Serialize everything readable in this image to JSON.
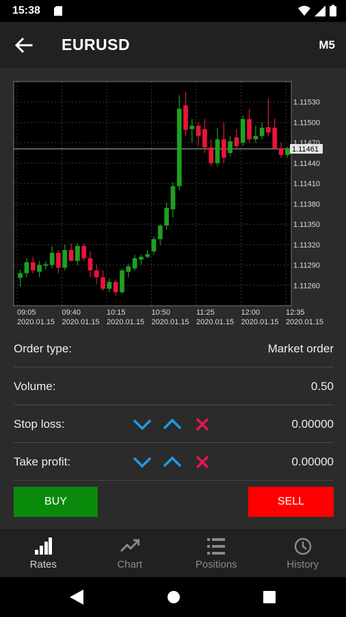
{
  "status_bar": {
    "time": "15:38"
  },
  "app_bar": {
    "title": "EURUSD",
    "timeframe": "M5"
  },
  "chart_data": {
    "type": "candlestick",
    "symbol": "EURUSD",
    "current_price_label": "1.11461",
    "current_price": 1.11461,
    "ylim": [
      1.1123,
      1.1156
    ],
    "y_ticks": [
      "1.11530",
      "1.11500",
      "1.11470",
      "1.11440",
      "1.11410",
      "1.11380",
      "1.11350",
      "1.11320",
      "1.11290",
      "1.11260"
    ],
    "x_ticks": [
      {
        "time": "09:05",
        "date": "2020.01.15"
      },
      {
        "time": "09:40",
        "date": "2020.01.15"
      },
      {
        "time": "10:15",
        "date": "2020.01.15"
      },
      {
        "time": "10:50",
        "date": "2020.01.15"
      },
      {
        "time": "11:25",
        "date": "2020.01.15"
      },
      {
        "time": "12:00",
        "date": "2020.01.15"
      },
      {
        "time": "12:35",
        "date": "2020.01.15"
      }
    ],
    "grid": true,
    "colors": {
      "up": "#1fa01f",
      "down": "#e8153c"
    },
    "candles": [
      {
        "o": 1.11271,
        "h": 1.11283,
        "l": 1.11258,
        "c": 1.11278
      },
      {
        "o": 1.11278,
        "h": 1.113,
        "l": 1.11272,
        "c": 1.11294
      },
      {
        "o": 1.11294,
        "h": 1.11302,
        "l": 1.11278,
        "c": 1.11282
      },
      {
        "o": 1.1128,
        "h": 1.11296,
        "l": 1.11272,
        "c": 1.1129
      },
      {
        "o": 1.1129,
        "h": 1.11296,
        "l": 1.11283,
        "c": 1.11291
      },
      {
        "o": 1.1129,
        "h": 1.11318,
        "l": 1.11285,
        "c": 1.11308
      },
      {
        "o": 1.11308,
        "h": 1.11312,
        "l": 1.11278,
        "c": 1.11286
      },
      {
        "o": 1.11286,
        "h": 1.1132,
        "l": 1.11282,
        "c": 1.11312
      },
      {
        "o": 1.11312,
        "h": 1.11322,
        "l": 1.11296,
        "c": 1.11296
      },
      {
        "o": 1.11296,
        "h": 1.11322,
        "l": 1.1129,
        "c": 1.11318
      },
      {
        "o": 1.11318,
        "h": 1.11322,
        "l": 1.11296,
        "c": 1.113
      },
      {
        "o": 1.113,
        "h": 1.1131,
        "l": 1.11272,
        "c": 1.11282
      },
      {
        "o": 1.11282,
        "h": 1.1129,
        "l": 1.11262,
        "c": 1.11272
      },
      {
        "o": 1.11272,
        "h": 1.11282,
        "l": 1.11252,
        "c": 1.11255
      },
      {
        "o": 1.11255,
        "h": 1.1127,
        "l": 1.1125,
        "c": 1.11265
      },
      {
        "o": 1.11265,
        "h": 1.11268,
        "l": 1.11245,
        "c": 1.1125
      },
      {
        "o": 1.1125,
        "h": 1.11285,
        "l": 1.11248,
        "c": 1.11282
      },
      {
        "o": 1.1128,
        "h": 1.11292,
        "l": 1.11272,
        "c": 1.11288
      },
      {
        "o": 1.11285,
        "h": 1.11305,
        "l": 1.11282,
        "c": 1.113
      },
      {
        "o": 1.11298,
        "h": 1.11305,
        "l": 1.1129,
        "c": 1.11302
      },
      {
        "o": 1.11302,
        "h": 1.11312,
        "l": 1.113,
        "c": 1.11306
      },
      {
        "o": 1.1131,
        "h": 1.11332,
        "l": 1.11305,
        "c": 1.11328
      },
      {
        "o": 1.11328,
        "h": 1.1135,
        "l": 1.1132,
        "c": 1.11348
      },
      {
        "o": 1.11348,
        "h": 1.11382,
        "l": 1.11342,
        "c": 1.11374
      },
      {
        "o": 1.11372,
        "h": 1.11412,
        "l": 1.1136,
        "c": 1.11406
      },
      {
        "o": 1.11406,
        "h": 1.1154,
        "l": 1.114,
        "c": 1.1152
      },
      {
        "o": 1.11525,
        "h": 1.11545,
        "l": 1.1148,
        "c": 1.11489
      },
      {
        "o": 1.1149,
        "h": 1.11505,
        "l": 1.1147,
        "c": 1.11495
      },
      {
        "o": 1.11495,
        "h": 1.115,
        "l": 1.11465,
        "c": 1.1148
      },
      {
        "o": 1.1149,
        "h": 1.11505,
        "l": 1.11455,
        "c": 1.11463
      },
      {
        "o": 1.11463,
        "h": 1.11475,
        "l": 1.11435,
        "c": 1.1144
      },
      {
        "o": 1.1144,
        "h": 1.11492,
        "l": 1.11435,
        "c": 1.11475
      },
      {
        "o": 1.11475,
        "h": 1.115,
        "l": 1.1144,
        "c": 1.11448
      },
      {
        "o": 1.11455,
        "h": 1.1148,
        "l": 1.1145,
        "c": 1.11472
      },
      {
        "o": 1.11478,
        "h": 1.1149,
        "l": 1.1146,
        "c": 1.11465
      },
      {
        "o": 1.1147,
        "h": 1.1151,
        "l": 1.11465,
        "c": 1.11505
      },
      {
        "o": 1.11505,
        "h": 1.1152,
        "l": 1.1147,
        "c": 1.11475
      },
      {
        "o": 1.11475,
        "h": 1.11495,
        "l": 1.1147,
        "c": 1.1148
      },
      {
        "o": 1.1148,
        "h": 1.115,
        "l": 1.11475,
        "c": 1.11492
      },
      {
        "o": 1.11493,
        "h": 1.11535,
        "l": 1.1148,
        "c": 1.11485
      },
      {
        "o": 1.11492,
        "h": 1.11505,
        "l": 1.1147,
        "c": 1.11462
      },
      {
        "o": 1.11462,
        "h": 1.1147,
        "l": 1.11448,
        "c": 1.11452
      },
      {
        "o": 1.11452,
        "h": 1.11464,
        "l": 1.11448,
        "c": 1.11461
      }
    ]
  },
  "order_form": {
    "order_type": {
      "label": "Order type:",
      "value": "Market order"
    },
    "volume": {
      "label": "Volume:",
      "value": "0.50"
    },
    "stop_loss": {
      "label": "Stop loss:",
      "value": "0.00000"
    },
    "take_profit": {
      "label": "Take profit:",
      "value": "0.00000"
    },
    "icons": {
      "decrease": "chevron-down-icon",
      "increase": "chevron-up-icon",
      "clear": "close-icon"
    },
    "icon_colors": {
      "arrows": "#1e9be6",
      "clear": "#e8154e"
    }
  },
  "buttons": {
    "buy": "BUY",
    "sell": "SELL",
    "buy_color": "#0a8a0a",
    "sell_color": "#ff0000"
  },
  "bottom_nav": {
    "items": [
      {
        "label": "Rates",
        "icon": "bar-chart-icon",
        "active": true
      },
      {
        "label": "Chart",
        "icon": "trend-line-icon",
        "active": false
      },
      {
        "label": "Positions",
        "icon": "list-icon",
        "active": false
      },
      {
        "label": "History",
        "icon": "clock-icon",
        "active": false
      }
    ]
  }
}
